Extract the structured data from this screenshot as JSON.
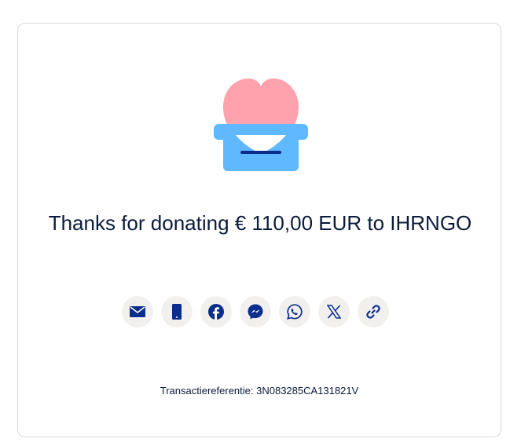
{
  "confirmation": {
    "headline": "Thanks for donating € 110,00 EUR to IHRNGO",
    "reference_label": "Transactiereferentie:",
    "reference_value": "3N083285CA131821V"
  },
  "share": {
    "buttons": [
      {
        "name": "email",
        "icon": "envelope-icon"
      },
      {
        "name": "sms",
        "icon": "phone-icon"
      },
      {
        "name": "facebook",
        "icon": "facebook-icon"
      },
      {
        "name": "messenger",
        "icon": "messenger-icon"
      },
      {
        "name": "whatsapp",
        "icon": "whatsapp-icon"
      },
      {
        "name": "x",
        "icon": "x-icon"
      },
      {
        "name": "copy-link",
        "icon": "link-icon"
      }
    ]
  },
  "colors": {
    "heart": "#ffa2ad",
    "box": "#60b9ff",
    "icon": "#0b2e8c",
    "text": "#0b1b3b"
  }
}
